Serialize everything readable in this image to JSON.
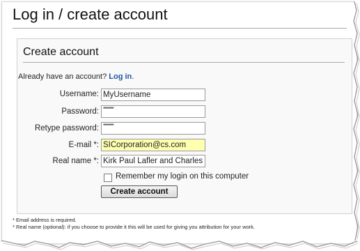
{
  "page": {
    "title": "Log in / create account"
  },
  "form": {
    "heading": "Create account",
    "already_text": "Already have an account?",
    "login_link": "Log in",
    "login_suffix": ".",
    "fields": {
      "username": {
        "label": "Username:",
        "value": "MyUsername"
      },
      "password": {
        "label": "Password:",
        "value": "*******"
      },
      "retype": {
        "label": "Retype password:",
        "value": "*******"
      },
      "email": {
        "label": "E-mail *:",
        "value": "SICorporation@cs.com"
      },
      "realname": {
        "label": "Real name *:",
        "value": "Kirk Paul Lafler and Charles"
      }
    },
    "remember_label": "Remember my login on this computer",
    "remember_checked": false,
    "submit_label": "Create account"
  },
  "notes": {
    "email_note": "* Email address is required.",
    "realname_note": "* Real name (optional): if you choose to provide it this will be used for giving you attribution for your work."
  },
  "colors": {
    "link": "#1a56a3",
    "email_highlight": "#ffffb0"
  }
}
